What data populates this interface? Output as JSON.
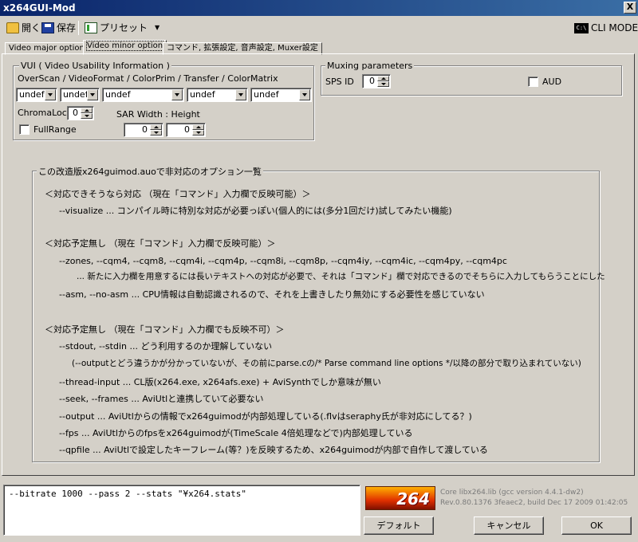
{
  "window": {
    "title": "x264GUI-Mod",
    "close": "X"
  },
  "toolbar": {
    "open": "開く",
    "save": "保存",
    "preset": "プリセット",
    "preset_arrow": "▼",
    "cli_icon": "C:\\",
    "cli_mode": "CLI MODE"
  },
  "tabs": [
    "Video major option",
    "Video minor option",
    "コマンド, 拡張設定, 音声設定, Muxer設定"
  ],
  "vui": {
    "title": "VUI ( Video Usability Information )",
    "combo_label": "OverScan / VideoFormat / ColorPrim / Transfer / ColorMatrix",
    "combos": [
      "undef",
      "undef",
      "undef",
      "undef",
      "undef"
    ],
    "chromaloc_label": "ChromaLoc",
    "chromaloc_value": "0",
    "sar_label": "SAR Width : Height",
    "sar_width": "0",
    "sar_height": "0",
    "fullrange_label": "FullRange"
  },
  "muxing": {
    "title": "Muxing parameters",
    "sps_label": "SPS ID",
    "sps_value": "0",
    "aud_label": "AUD"
  },
  "info": {
    "title": "この改造版x264guimod.auoで非対応のオプション一覧",
    "lines": [
      "＜対応できそうなら対応 （現在「コマンド」入力欄で反映可能）＞",
      "--visualize ... コンパイル時に特別な対応が必要っぽい(個人的には(多分1回だけ)試してみたい機能)",
      "＜対応予定無し （現在「コマンド」入力欄で反映可能）＞",
      "--zones, --cqm4, --cqm8, --cqm4i, --cqm4p, --cqm8i, --cqm8p, --cqm4iy, --cqm4ic, --cqm4py, --cqm4pc",
      "... 新たに入力欄を用意するには長いテキストへの対応が必要で、それは「コマンド」欄で対応できるのでそちらに入力してもらうことにした",
      "--asm, --no-asm ... CPU情報は自動認識されるので、それを上書きしたり無効にする必要性を感じていない",
      "＜対応予定無し （現在「コマンド」入力欄でも反映不可）＞",
      "--stdout, --stdin ... どう利用するのか理解していない",
      "(--outputとどう違うかが分かっていないが、その前にparse.cの/* Parse command line options */以降の部分で取り込まれていない)",
      "--thread-input ... CL版(x264.exe, x264afs.exe) + AviSynthでしか意味が無い",
      "--seek, --frames ... AviUtlと連携していて必要ない",
      "--output ... AviUtlからの情報でx264guimodが内部処理している(.flvはseraphy氏が非対応にしてる？)",
      "--fps ... AviUtlからのfpsをx264guimodが(TimeScale 4倍処理などで)内部処理している",
      "--qpfile ... AviUtlで設定したキーフレーム(等？)を反映するため、x264guimodが内部で自作して渡している"
    ]
  },
  "command": {
    "value": "--bitrate 1000 --pass 2 --stats \"¥x264.stats\""
  },
  "logo": {
    "text": "264"
  },
  "version": {
    "line1": "Core libx264.lib (gcc version 4.4.1-dw2)",
    "line2": "Rev.0.80.1376 3feaec2, build Dec 17 2009 01:42:05"
  },
  "buttons": {
    "default": "デフォルト",
    "cancel": "キャンセル",
    "ok": "OK"
  }
}
